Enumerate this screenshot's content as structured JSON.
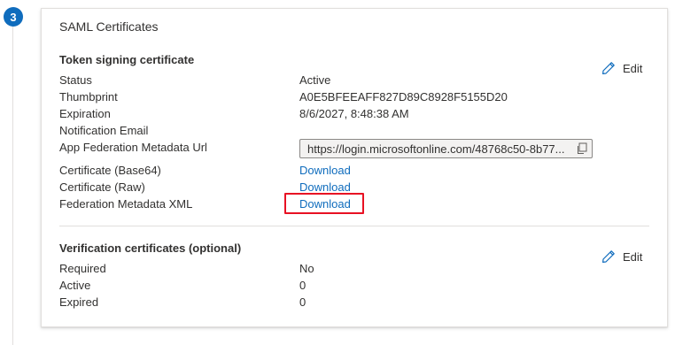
{
  "step": {
    "number": "3"
  },
  "card": {
    "title": "SAML Certificates",
    "token_signing": {
      "heading": "Token signing certificate",
      "edit_label": "Edit",
      "rows": {
        "status": {
          "label": "Status",
          "value": "Active"
        },
        "thumbprint": {
          "label": "Thumbprint",
          "value": "A0E5BFEEAFF827D89C8928F5155D20"
        },
        "expiration": {
          "label": "Expiration",
          "value": "8/6/2027, 8:48:38 AM"
        },
        "notification_email": {
          "label": "Notification Email",
          "value": ""
        },
        "metadata_url": {
          "label": "App Federation Metadata Url",
          "value": "https://login.microsoftonline.com/48768c50-8b77..."
        },
        "cert_base64": {
          "label": "Certificate (Base64)",
          "value": "Download"
        },
        "cert_raw": {
          "label": "Certificate (Raw)",
          "value": "Download"
        },
        "federation_xml": {
          "label": "Federation Metadata XML",
          "value": "Download"
        }
      }
    },
    "verification": {
      "heading": "Verification certificates (optional)",
      "edit_label": "Edit",
      "rows": {
        "required": {
          "label": "Required",
          "value": "No"
        },
        "active": {
          "label": "Active",
          "value": "0"
        },
        "expired": {
          "label": "Expired",
          "value": "0"
        }
      }
    }
  },
  "colors": {
    "accent": "#0f6cbd",
    "highlight": "#e81123",
    "step_badge": "#0f6cbd"
  },
  "icons": {
    "edit": "pencil-icon",
    "copy": "copy-icon"
  }
}
